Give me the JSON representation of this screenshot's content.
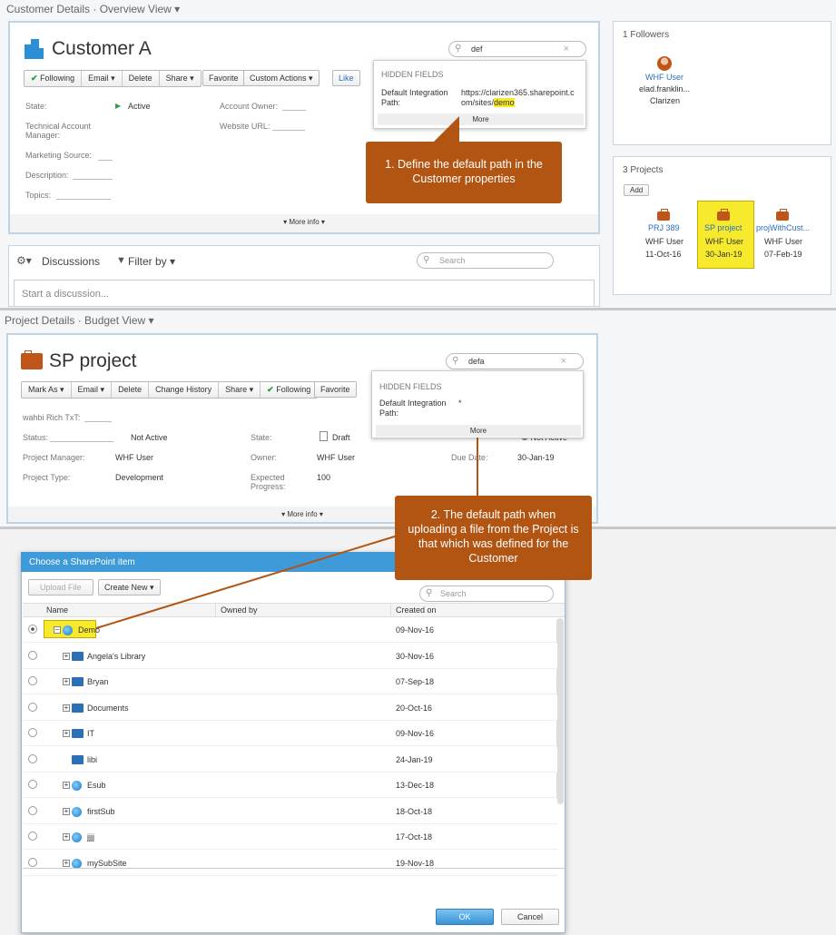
{
  "customer": {
    "header": "Customer Details · Overview View ▾",
    "title": "Customer A",
    "search_value": "def",
    "toolbar": [
      "Following",
      "Email ▾",
      "Delete",
      "Share ▾"
    ],
    "favorite": "Favorite",
    "custom_actions": "Custom Actions ▾",
    "like": "Like",
    "fields": {
      "state_label": "State:",
      "state_value": "Active",
      "tam_label": "Technical Account Manager:",
      "marketing_label": "Marketing Source:",
      "description_label": "Description:",
      "topics_label": "Topics:",
      "owner_label": "Account Owner:",
      "website_label": "Website URL:"
    },
    "more_info": "▾ More info ▾",
    "hidden": {
      "title": "HIDDEN FIELDS",
      "field_label": "Default Integration Path:",
      "field_value_a": "https://clarizen365.sharepoint.c",
      "field_value_b": "om/sites/",
      "field_value_hl": "demo",
      "more": "More"
    },
    "callout": "1. Define the default path in the Customer properties",
    "discussions": "Discussions",
    "filter_by": "Filter by ▾",
    "search_placeholder": "Search",
    "discussion_placeholder": "Start a discussion..."
  },
  "followers": {
    "title": "1 Followers",
    "name": "WHF User",
    "email": "elad.franklin...",
    "company": "Clarizen"
  },
  "projects": {
    "title": "3 Projects",
    "add": "Add",
    "items": [
      {
        "name": "PRJ 389",
        "owner": "WHF User",
        "date": "11-Oct-16"
      },
      {
        "name": "SP project",
        "owner": "WHF User",
        "date": "30-Jan-19"
      },
      {
        "name": "projWithCust...",
        "owner": "WHF User",
        "date": "07-Feb-19"
      }
    ]
  },
  "project": {
    "header": "Project Details · Budget View ▾",
    "title": "SP project",
    "search_value": "defa",
    "toolbar": [
      "Mark As ▾",
      "Email ▾",
      "Delete",
      "Change History",
      "Share ▾",
      "Following"
    ],
    "favorite": "Favorite",
    "fields": {
      "rich_label": "wahbi Rich TxT:",
      "status_label": "Status:",
      "status_value": "Not Active",
      "pm_label": "Project Manager:",
      "pm_value": "WHF User",
      "type_label": "Project Type:",
      "type_value": "Development",
      "state_label": "State:",
      "state_value": "Draft",
      "owner_label": "Owner:",
      "owner_value": "WHF User",
      "progress_label": "Expected Progress:",
      "progress_value": "100",
      "due_label": "Due Date:",
      "due_value": "30-Jan-19",
      "budget_status_value": "Not Active"
    },
    "more_info": "▾ More info ▾",
    "hidden": {
      "title": "HIDDEN FIELDS",
      "field_label": "Default Integration Path:",
      "field_value": "*",
      "more": "More"
    },
    "callout": "2. The default path when uploading a file from the Project is that which was defined for the Customer"
  },
  "dialog": {
    "title": "Choose a SharePoint item",
    "upload": "Upload File",
    "create_new": "Create New ▾",
    "search_placeholder": "Search",
    "columns": [
      "Name",
      "Owned by",
      "Created on"
    ],
    "rows": [
      {
        "name": "Demo",
        "date": "09-Nov-16",
        "icon": "globe-icon"
      },
      {
        "name": "Angela's Library",
        "date": "30-Nov-16",
        "icon": "folder-icon"
      },
      {
        "name": "Bryan",
        "date": "07-Sep-18",
        "icon": "folder-icon"
      },
      {
        "name": "Documents",
        "date": "20-Oct-16",
        "icon": "folder-icon"
      },
      {
        "name": "IT",
        "date": "09-Nov-16",
        "icon": "folder-icon"
      },
      {
        "name": "libi",
        "date": "24-Jan-19",
        "icon": "folder-icon"
      },
      {
        "name": "Esub",
        "date": "13-Dec-18",
        "icon": "globe-icon"
      },
      {
        "name": "firstSub",
        "date": "18-Oct-18",
        "icon": "globe-icon"
      },
      {
        "name": "jjjj",
        "date": "17-Oct-18",
        "icon": "globe-icon"
      },
      {
        "name": "mySubSite",
        "date": "19-Nov-18",
        "icon": "globe-icon"
      }
    ],
    "ok": "OK",
    "cancel": "Cancel"
  },
  "colors": {
    "accent": "#b25513",
    "highlight": "#f7e92c",
    "dialog_header": "#3e9ad8",
    "link": "#2a6ebd"
  }
}
